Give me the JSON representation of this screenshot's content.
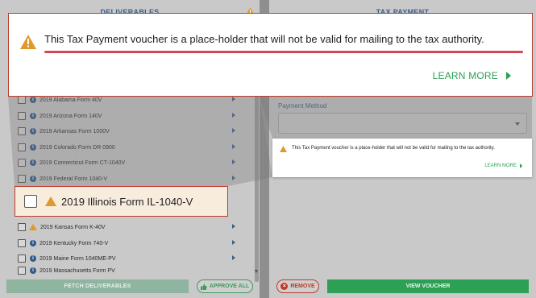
{
  "left": {
    "title": "DELIVERABLES",
    "items": [
      {
        "label": "2019 Alabama Form 40V",
        "icon": "info"
      },
      {
        "label": "2019 Arizona Form 140V",
        "icon": "info"
      },
      {
        "label": "2019 Arkansas Form 1000V",
        "icon": "info"
      },
      {
        "label": "2019 Colorado Form DR 0900",
        "icon": "info"
      },
      {
        "label": "2019 Connecticut Form CT-1040V",
        "icon": "info"
      },
      {
        "label": "2019 Federal Form 1040-V",
        "icon": "info"
      },
      {
        "label": "2019 Kansas Form K-40V",
        "icon": "warning"
      },
      {
        "label": "2019 Kentucky Form 740-V",
        "icon": "info"
      },
      {
        "label": "2019 Maine Form 1040ME-PV",
        "icon": "info"
      },
      {
        "label": "2019 Massachusetts Form PV",
        "icon": "info"
      }
    ],
    "fetch_label": "FETCH DELIVERABLES",
    "approve_label": "APPROVE ALL"
  },
  "right": {
    "title": "TAX PAYMENT",
    "payment_method_label": "Payment Method",
    "payment_method_value": "",
    "remove_label": "REMOVE",
    "view_label": "VIEW VOUCHER"
  },
  "notice": {
    "message": "This Tax Payment voucher is a place-holder that will not be valid for mailing to the tax authority.",
    "learn_more": "LEARN MORE"
  },
  "highlighted_item": {
    "label": "2019 Illinois Form IL-1040-V"
  },
  "colors": {
    "accent_green": "#2ea055",
    "warning_orange": "#e09a2a",
    "highlight_red": "#c0392b",
    "header_blue": "#3d5f86"
  }
}
